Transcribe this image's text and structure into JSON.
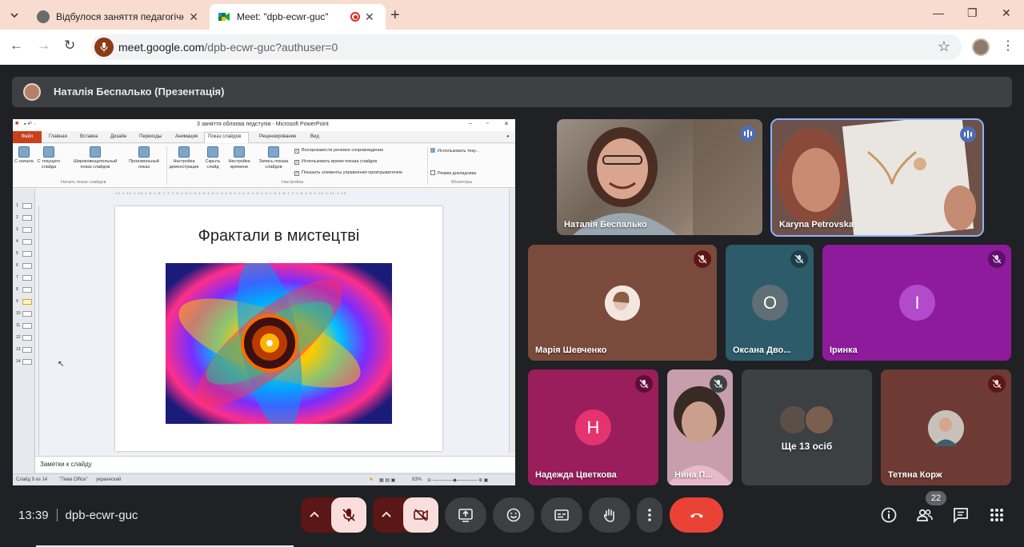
{
  "browser": {
    "tabs": [
      {
        "title": "Відбулося заняття педагогічно",
        "close": "✕"
      },
      {
        "title": "Meet: \"dpb-ecwr-guc\"",
        "close": "✕"
      }
    ],
    "url_domain": "meet.google.com",
    "url_path": "/dpb-ecwr-guc?authuser=0"
  },
  "presenter": {
    "label": "Наталія Беспалько (Презентація)"
  },
  "powerpoint": {
    "window_title": "3 заняття облоєва педступія - Microsoft PowerPoint",
    "menu": [
      "Файл",
      "Главная",
      "Вставка",
      "Дизайн",
      "Переходы",
      "Анимация",
      "Показ слайдов",
      "Рецензирование",
      "Вид"
    ],
    "ribbon_buttons": [
      "С начала",
      "С текущего слайда",
      "Широковещательный показ слайдов",
      "Произвольный показ",
      "Настройка демонстрации",
      "Скрыть слайд",
      "Настройка времени",
      "Запись показа слайдов"
    ],
    "ribbon_checks": [
      "Воспроизвести речевое сопровождение",
      "Использовать время показа слайдов",
      "Показать элементы управления проигрывателем"
    ],
    "monitor_select": "Использовать теку...",
    "presenter_mode": "Режим докладчика",
    "groups": [
      "Начать показ слайдов",
      "Настройка",
      "Мониторы"
    ],
    "thumbnail_numbers": [
      "1",
      "2",
      "3",
      "4",
      "5",
      "6",
      "7",
      "8",
      "9",
      "10",
      "11",
      "12",
      "13",
      "14"
    ],
    "ruler_text": "·12·1·11·1·10·1·9·1·8·1·7·1·6·1·5·1·4·1·3·1·2·1·1·1·0·1·1·1·2·1·3·1·4·1·5·1·6·1·7·1·8·1·9·1·10·1·11·1·12·",
    "slide_title": "Фрактали в мистецтві",
    "notes_placeholder": "Заметки к слайду",
    "status_slide": "Слайд 9 из 14",
    "status_theme": "\"Тема Office\"",
    "status_lang": "украинский",
    "zoom": "83%"
  },
  "participants": [
    {
      "name": "Наталія Беспалько",
      "muted": false,
      "speaking": true
    },
    {
      "name": "Karyna Petrovska",
      "muted": false,
      "speaking": true
    },
    {
      "name": "Марія Шевченко",
      "muted": true
    },
    {
      "name": "Оксана Дво...",
      "initial": "О",
      "muted": true
    },
    {
      "name": "Іринка",
      "initial": "І",
      "muted": true
    },
    {
      "name": "Надежда Цветкова",
      "initial": "Н",
      "muted": true
    },
    {
      "name": "Нина П...",
      "muted": true
    },
    {
      "name": "Ще 13 осіб"
    },
    {
      "name": "Тетяна Корж",
      "muted": true
    }
  ],
  "colors": {
    "muted_bg": "#5b1616",
    "hangup": "#ea4335",
    "speaking": "#4f6db3",
    "bar": "#3c4043"
  },
  "meeting": {
    "time": "13:39",
    "code": "dpb-ecwr-guc",
    "participants_count": "22"
  },
  "icons": [
    "mic-off-icon",
    "camera-off-icon",
    "present-icon",
    "emoji-icon",
    "captions-icon",
    "hand-icon",
    "more-icon",
    "hangup-icon",
    "info-icon",
    "people-icon",
    "chat-icon",
    "activities-icon"
  ]
}
